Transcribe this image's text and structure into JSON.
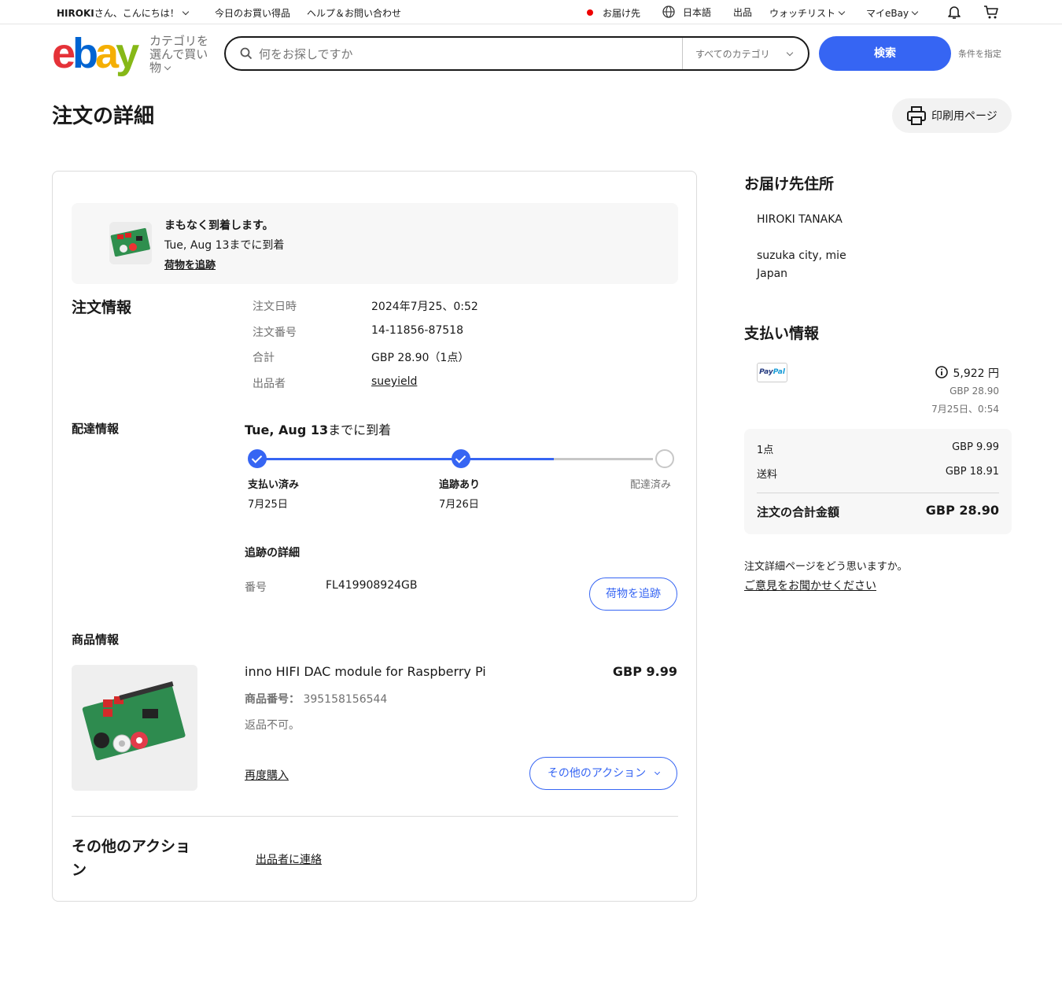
{
  "topbar": {
    "greeting_name": "HIROKI",
    "greeting_rest": "さん、こんにちは！",
    "deals": "今日のお買い得品",
    "help": "ヘルプ＆お問い合わせ",
    "ship_to": "お届け先",
    "language": "日本語",
    "sell": "出品",
    "watchlist": "ウォッチリスト",
    "my_ebay": "マイeBay"
  },
  "header": {
    "logo": {
      "e": "e",
      "b": "b",
      "a": "a",
      "y": "y"
    },
    "category_shop": "カテゴリを選んで買い物",
    "search_placeholder": "何をお探しですか",
    "all_categories": "すべてのカテゴリ",
    "search_button": "検索",
    "advanced": "条件を指定"
  },
  "page": {
    "title": "注文の詳細",
    "print_label": "印刷用ページ"
  },
  "notice": {
    "line1": "まもなく到着します。",
    "line2": "Tue, Aug 13までに到着",
    "track_link": "荷物を追跡"
  },
  "order_info": {
    "heading": "注文情報",
    "rows": [
      {
        "label": "注文日時",
        "value": "2024年7月25、0:52"
      },
      {
        "label": "注文番号",
        "value": "14-11856-87518"
      },
      {
        "label": "合計",
        "value": "GBP 28.90（1点）"
      },
      {
        "label": "出品者",
        "value": "sueyield"
      }
    ]
  },
  "delivery": {
    "heading": "配達情報",
    "eta_bold": "Tue, Aug 13",
    "eta_rest": "までに到着",
    "steps": [
      {
        "label": "支払い済み",
        "date": "7月25日",
        "status": "done"
      },
      {
        "label": "追跡あり",
        "date": "7月26日",
        "status": "done"
      },
      {
        "label": "配達済み",
        "date": "",
        "status": "pending"
      }
    ],
    "progress_fraction": 0.75,
    "tracking_heading": "追跡の詳細",
    "tracking_label": "番号",
    "tracking_number": "FL419908924GB",
    "track_button": "荷物を追跡"
  },
  "item": {
    "heading": "商品情報",
    "title": "inno HIFI DAC module for Raspberry Pi",
    "price": "GBP 9.99",
    "number_label": "商品番号：",
    "number": "395158156544",
    "returns": "返品不可。",
    "rebuy": "再度購入",
    "more_actions": "その他のアクション"
  },
  "other": {
    "heading_line1": "その他のアクショ",
    "heading_line2": "ン",
    "contact": "出品者に連絡"
  },
  "shipping_address": {
    "heading": "お届け先住所",
    "name": "HIROKI TANAKA",
    "line1": "suzuka city, mie",
    "line2": "Japan"
  },
  "payment": {
    "heading": "支払い情報",
    "method": {
      "p1": "Pay",
      "p2": "Pal"
    },
    "amount_yen": "5,922 円",
    "amount_gbp": "GBP 28.90",
    "paid_at": "7月25日、0:54",
    "items_label": "1点",
    "items_value": "GBP 9.99",
    "shipping_label": "送料",
    "shipping_value": "GBP 18.91",
    "total_label": "注文の合計金額",
    "total_value": "GBP 28.90"
  },
  "feedback": {
    "question": "注文詳細ページをどう思いますか。",
    "link": "ご意見をお聞かせください"
  },
  "colors": {
    "accent": "#3665f3",
    "track_gray": "#c7c7c7"
  }
}
